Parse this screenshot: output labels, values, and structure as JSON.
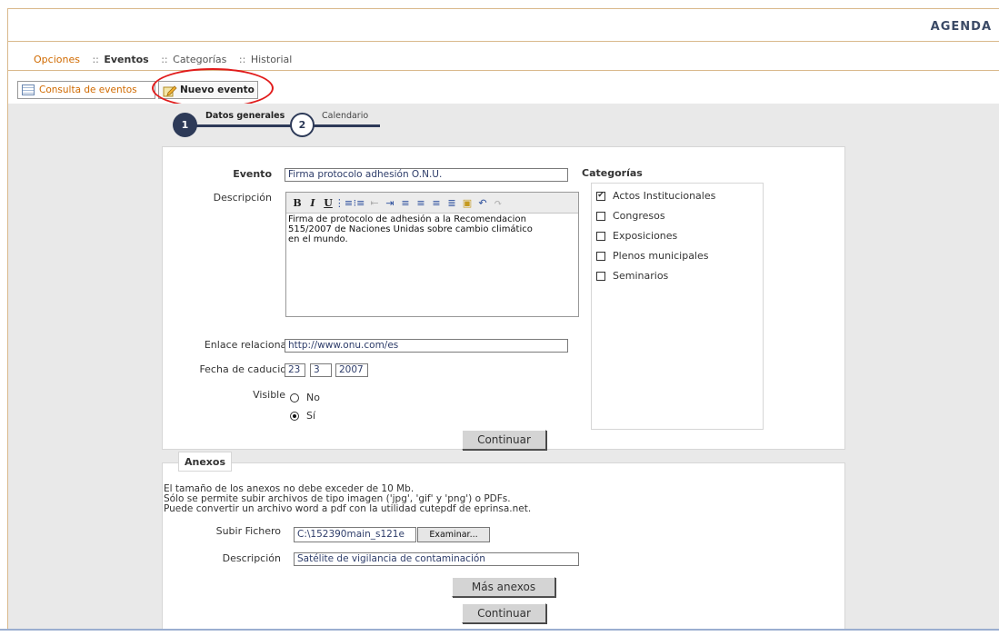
{
  "app": {
    "title": "AGENDA"
  },
  "menu": {
    "opciones": "Opciones",
    "sep": "::",
    "eventos": "Eventos",
    "categorias": "Categorías",
    "historial": "Historial"
  },
  "tabs": [
    {
      "label": "Consulta de eventos",
      "icon": "table-icon"
    },
    {
      "label": "Nuevo evento",
      "icon": "edit-icon",
      "active": true
    }
  ],
  "steps": [
    {
      "number": "1",
      "label": "Datos generales",
      "active": true
    },
    {
      "number": "2",
      "label": "Calendario",
      "active": false
    }
  ],
  "form": {
    "evento_label": "Evento",
    "evento_value": "Firma protocolo adhesión O.N.U.",
    "descripcion_label": "Descripción",
    "descripcion_text": "Firma de protocolo de adhesión a la Recomendacion\n515/2007 de Naciones Unidas sobre cambio climático\nen el mundo.",
    "enlace_label": "Enlace relacionado",
    "enlace_value": "http://www.onu.com/es",
    "fecha_label": "Fecha de caducidad",
    "fecha_dia": "23",
    "fecha_mes": "3",
    "fecha_anio": "2007",
    "visible_label": "Visible",
    "visible_options": [
      "No",
      "Sí"
    ],
    "visible_selected": "Sí",
    "continuar": "Continuar"
  },
  "categorias": {
    "title": "Categorías",
    "items": [
      {
        "label": "Actos Institucionales",
        "checked": true
      },
      {
        "label": "Congresos",
        "checked": false
      },
      {
        "label": "Exposiciones",
        "checked": false
      },
      {
        "label": "Plenos municipales",
        "checked": false
      },
      {
        "label": "Seminarios",
        "checked": false
      }
    ]
  },
  "anexos": {
    "title": "Anexos",
    "note1": "El tamaño de los anexos no debe exceder de 10 Mb.",
    "note2": "Sólo se permite subir archivos de tipo imagen ('jpg', 'gif' y 'png') o PDFs.",
    "note3": "Puede convertir un archivo word a pdf con la utilidad cutepdf de eprinsa.net.",
    "subir_label": "Subir Fichero",
    "subir_value": "C:\\152390main_s121e",
    "examinar": "Examinar...",
    "descripcion_label": "Descripción",
    "descripcion_value": "Satélite de vigilancia de contaminación",
    "mas_anexos": "Más anexos",
    "continuar": "Continuar"
  },
  "colors": {
    "accent": "#d06a00",
    "navy": "#2d3a58",
    "highlight": "#e11b1b",
    "background": "#e9e9e9"
  }
}
